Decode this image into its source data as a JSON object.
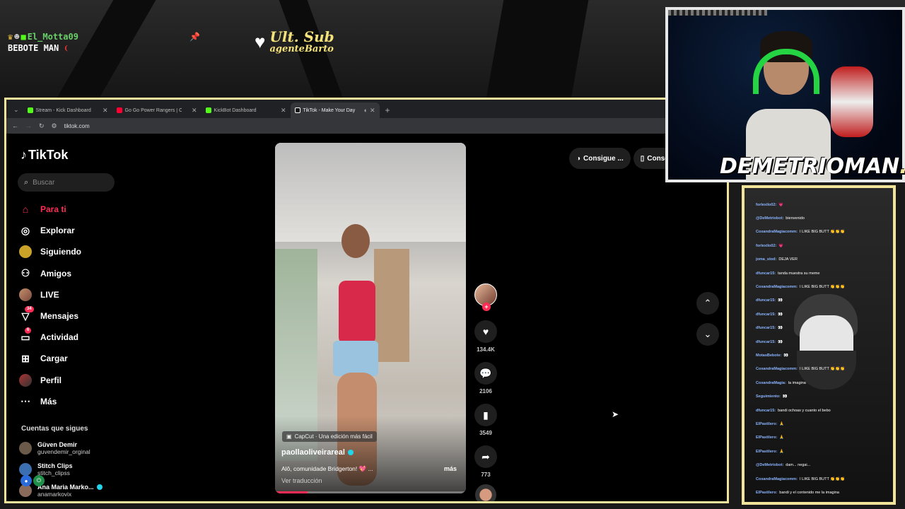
{
  "overlay": {
    "user_name": "El_Motta09",
    "user_line2": "BEBOTE MAN",
    "sub_title": "Ult. Sub",
    "sub_name": "agenteBarto",
    "streamer_name": "DEMETRIOMAN",
    "streamer_suffix": "..."
  },
  "browser": {
    "tabs": [
      {
        "title": "Stream - Kick Dashboard",
        "color": "#53fc18"
      },
      {
        "title": "Go Go Power Rangers | Once u",
        "color": "#ff0033"
      },
      {
        "title": "KickBot Dashboard",
        "color": "#53fc18"
      },
      {
        "title": "TikTok - Make Your Day",
        "color": "#ffffff"
      }
    ],
    "url": "tiktok.com"
  },
  "tiktok": {
    "logo": "TikTok",
    "search_placeholder": "Buscar",
    "nav": [
      {
        "label": "Para ti",
        "icon": "home-icon",
        "badge": ""
      },
      {
        "label": "Explorar",
        "icon": "compass-icon",
        "badge": ""
      },
      {
        "label": "Siguiendo",
        "icon": "following-icon",
        "badge": ""
      },
      {
        "label": "Amigos",
        "icon": "friends-icon",
        "badge": ""
      },
      {
        "label": "LIVE",
        "icon": "live-icon",
        "badge": ""
      },
      {
        "label": "Mensajes",
        "icon": "messages-icon",
        "badge": "34"
      },
      {
        "label": "Actividad",
        "icon": "activity-icon",
        "badge": "6"
      },
      {
        "label": "Cargar",
        "icon": "upload-icon",
        "badge": ""
      },
      {
        "label": "Perfil",
        "icon": "profile-icon",
        "badge": ""
      },
      {
        "label": "Más",
        "icon": "more-icon",
        "badge": ""
      }
    ],
    "following_title": "Cuentas que sigues",
    "following": [
      {
        "name": "Güven Demir",
        "handle": "guvendemir_orginal"
      },
      {
        "name": "Stitch Clips",
        "handle": "stitch_clipss"
      },
      {
        "name": "Ana Maria Marko...",
        "handle": "anamarkovix"
      }
    ],
    "get_app_1": "Consigue ...",
    "get_app_2": "Consegui",
    "video": {
      "capcut": "CapCut · Una edición más fácil",
      "username": "paollaoliveirareal",
      "description": "Alô, comunidade Bridgerton! 💖 ...",
      "more": "más",
      "translate": "Ver traducción",
      "progress": 0.17
    },
    "actions": {
      "likes": "134.4K",
      "comments": "2106",
      "saves": "3549",
      "shares": "773"
    }
  },
  "chat": {
    "lines": [
      {
        "user": "forlexilo02",
        "msg": "💗"
      },
      {
        "user": "@DeMetriobot",
        "msg": "bienvenido"
      },
      {
        "user": "CoxandraMagiacomm",
        "msg": "I LIKE BIG BUTT 👏👏👏"
      },
      {
        "user": "forlexilo02",
        "msg": "💗"
      },
      {
        "user": "joma_stod",
        "msg": "DEJA VER"
      },
      {
        "user": "dfuncar15",
        "msg": "tanda muestra su meme"
      },
      {
        "user": "CoxandraMagiacomm",
        "msg": "I LIKE BIG BUTT 👏👏👏"
      },
      {
        "user": "dfuncar15",
        "msg": "👀"
      },
      {
        "user": "dfuncar15",
        "msg": "👀"
      },
      {
        "user": "dfuncar15",
        "msg": "👀"
      },
      {
        "user": "dfuncar15",
        "msg": "👀"
      },
      {
        "user": "MotasBebote",
        "msg": "👀"
      },
      {
        "user": "CoxandraMagiacomm",
        "msg": "I LIKE BIG BUTT 👏👏👏"
      },
      {
        "user": "CoxandraMagia",
        "msg": "la imagina"
      },
      {
        "user": "Seguimiento",
        "msg": "👀"
      },
      {
        "user": "dfuncar15",
        "msg": "bandi ochoas y cuanto el bebo"
      },
      {
        "user": "ElPastilero",
        "msg": "🙏"
      },
      {
        "user": "ElPastilero",
        "msg": "🙏"
      },
      {
        "user": "ElPastilero",
        "msg": "🙏"
      },
      {
        "user": "@DeMetriobot",
        "msg": "dam... negai..."
      },
      {
        "user": "CoxandraMagiacomm",
        "msg": "I LIKE BIG BUTT 👏👏👏"
      },
      {
        "user": "ElPastilero",
        "msg": "bandi y el contenido me la imagina"
      }
    ]
  }
}
